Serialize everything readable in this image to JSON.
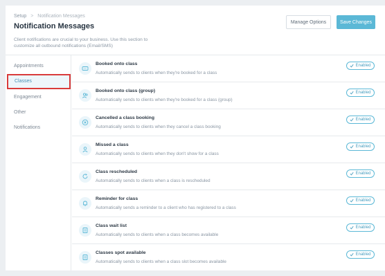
{
  "breadcrumb": {
    "root": "Setup",
    "separator": ">",
    "current": "Notification Messages"
  },
  "page": {
    "title": "Notification Messages",
    "description": "Client notifications are crucial to your business. Use this section to customize all outbound notifications (Email/SMS)"
  },
  "buttons": {
    "manage": "Manage Options",
    "save": "Save Changes"
  },
  "colors": {
    "accent": "#5bb8d6",
    "highlight": "#d93a3a"
  },
  "sidebar": {
    "items": [
      {
        "label": "Appointments",
        "active": false
      },
      {
        "label": "Classes",
        "active": true
      },
      {
        "label": "Engagement",
        "active": false
      },
      {
        "label": "Other",
        "active": false
      },
      {
        "label": "Notifications",
        "active": false
      }
    ]
  },
  "notifications": [
    {
      "title": "Booked onto class",
      "description": "Automatically sends to clients when they're booked for a class",
      "status": "Enabled",
      "icon": "ticket-icon"
    },
    {
      "title": "Booked onto class (group)",
      "description": "Automatically sends to clients when they're booked for a class (group)",
      "status": "Enabled",
      "icon": "group-icon"
    },
    {
      "title": "Cancelled a class booking",
      "description": "Automatically sends to clients when they cancel a class booking",
      "status": "Enabled",
      "icon": "cancel-circle-icon"
    },
    {
      "title": "Missed a class",
      "description": "Automatically sends to clients when they don't show for a class",
      "status": "Enabled",
      "icon": "person-icon"
    },
    {
      "title": "Class rescheduled",
      "description": "Automatically sends to clients when a class is rescheduled",
      "status": "Enabled",
      "icon": "refresh-icon"
    },
    {
      "title": "Reminder for class",
      "description": "Automatically sends a reminder to a client who has registered to a class",
      "status": "Enabled",
      "icon": "bell-icon"
    },
    {
      "title": "Class wait list",
      "description": "Automatically sends to clients when a class becomes available",
      "status": "Enabled",
      "icon": "list-icon"
    },
    {
      "title": "Classes spot available",
      "description": "Automatically sends to clients when a class slot becomes available",
      "status": "Enabled",
      "icon": "list-icon"
    }
  ]
}
